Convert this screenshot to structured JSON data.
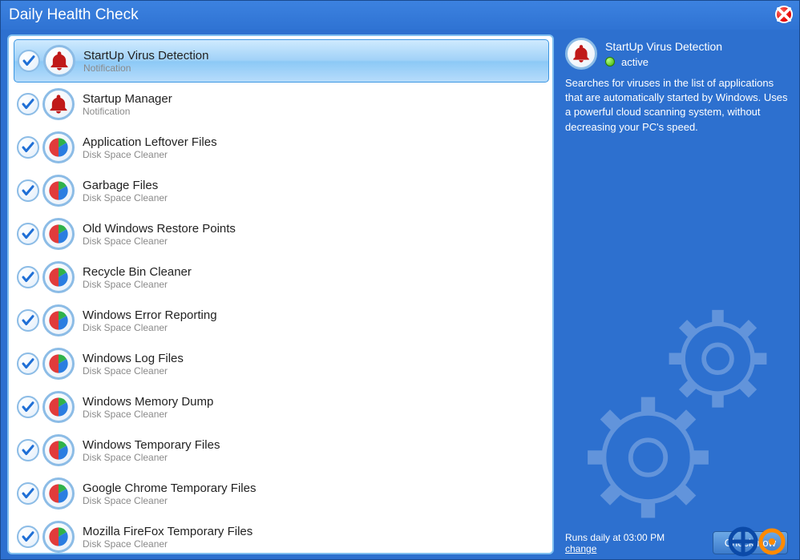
{
  "window": {
    "title": "Daily Health Check"
  },
  "items": [
    {
      "title": "StartUp Virus Detection",
      "sub": "Notification",
      "icon": "bell",
      "selected": true
    },
    {
      "title": "Startup Manager",
      "sub": "Notification",
      "icon": "bell",
      "selected": false
    },
    {
      "title": "Application Leftover Files",
      "sub": "Disk Space Cleaner",
      "icon": "pie",
      "selected": false
    },
    {
      "title": "Garbage Files",
      "sub": "Disk Space Cleaner",
      "icon": "pie",
      "selected": false
    },
    {
      "title": "Old Windows Restore Points",
      "sub": "Disk Space Cleaner",
      "icon": "pie",
      "selected": false
    },
    {
      "title": "Recycle Bin Cleaner",
      "sub": "Disk Space Cleaner",
      "icon": "pie",
      "selected": false
    },
    {
      "title": "Windows Error Reporting",
      "sub": "Disk Space Cleaner",
      "icon": "pie",
      "selected": false
    },
    {
      "title": "Windows Log Files",
      "sub": "Disk Space Cleaner",
      "icon": "pie",
      "selected": false
    },
    {
      "title": "Windows Memory Dump",
      "sub": "Disk Space Cleaner",
      "icon": "pie",
      "selected": false
    },
    {
      "title": "Windows Temporary Files",
      "sub": "Disk Space Cleaner",
      "icon": "pie",
      "selected": false
    },
    {
      "title": "Google Chrome Temporary Files",
      "sub": "Disk Space Cleaner",
      "icon": "pie",
      "selected": false
    },
    {
      "title": "Mozilla FireFox Temporary Files",
      "sub": "Disk Space Cleaner",
      "icon": "pie",
      "selected": false
    }
  ],
  "detail": {
    "title": "StartUp Virus Detection",
    "status": "active",
    "description": "Searches for viruses in the list of applications that are automatically started by Windows. Uses a powerful cloud scanning system, without decreasing your PC's speed."
  },
  "footer": {
    "schedule": "Runs daily at 03:00 PM",
    "change": "change",
    "check_now": "Check now"
  }
}
